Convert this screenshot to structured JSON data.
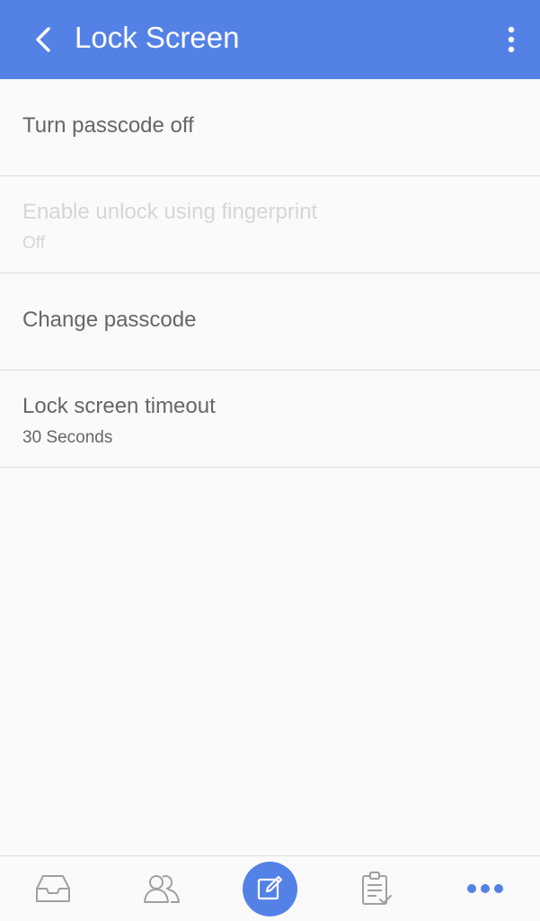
{
  "header": {
    "title": "Lock Screen",
    "back_icon": "chevron-left-icon",
    "menu_icon": "more-vertical-icon",
    "background": "#5381e6"
  },
  "settings": [
    {
      "label": "Turn passcode off",
      "enabled": true
    },
    {
      "label": "Enable unlock using fingerprint",
      "value": "Off",
      "enabled": false
    },
    {
      "label": "Change passcode",
      "enabled": true
    },
    {
      "label": "Lock screen timeout",
      "value": "30 Seconds",
      "enabled": true
    }
  ],
  "bottom_nav": {
    "items": [
      {
        "icon": "inbox-tray-icon"
      },
      {
        "icon": "contacts-icon"
      },
      {
        "icon": "compose-icon",
        "accent": "#5381e6"
      },
      {
        "icon": "tasks-clipboard-icon"
      },
      {
        "icon": "more-horizontal-icon"
      }
    ]
  }
}
